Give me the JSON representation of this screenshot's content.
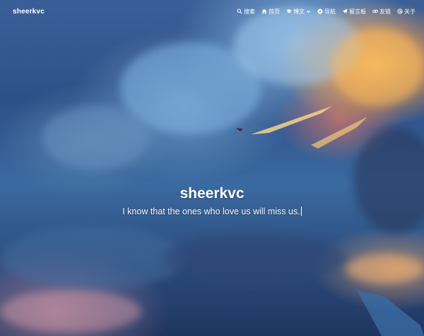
{
  "nav": {
    "brand": "sheerkvc",
    "items": [
      {
        "label": "搜索",
        "icon": "search-icon"
      },
      {
        "label": "首页",
        "icon": "home-icon"
      },
      {
        "label": "博文",
        "icon": "graduation-cap-icon",
        "dropdown": true
      },
      {
        "label": "导航",
        "icon": "compass-icon"
      },
      {
        "label": "留言板",
        "icon": "paper-plane-icon"
      },
      {
        "label": "友链",
        "icon": "link-icon"
      },
      {
        "label": "关于",
        "icon": "at-icon"
      }
    ]
  },
  "hero": {
    "title": "sheerkvc",
    "subtitle": "I know that the ones who love us will miss us."
  },
  "colors": {
    "text": "#ffffff",
    "sky_dark": "#1f3560",
    "sky_mid": "#3a6aa0",
    "cloud_warm": "#f5b75a"
  }
}
